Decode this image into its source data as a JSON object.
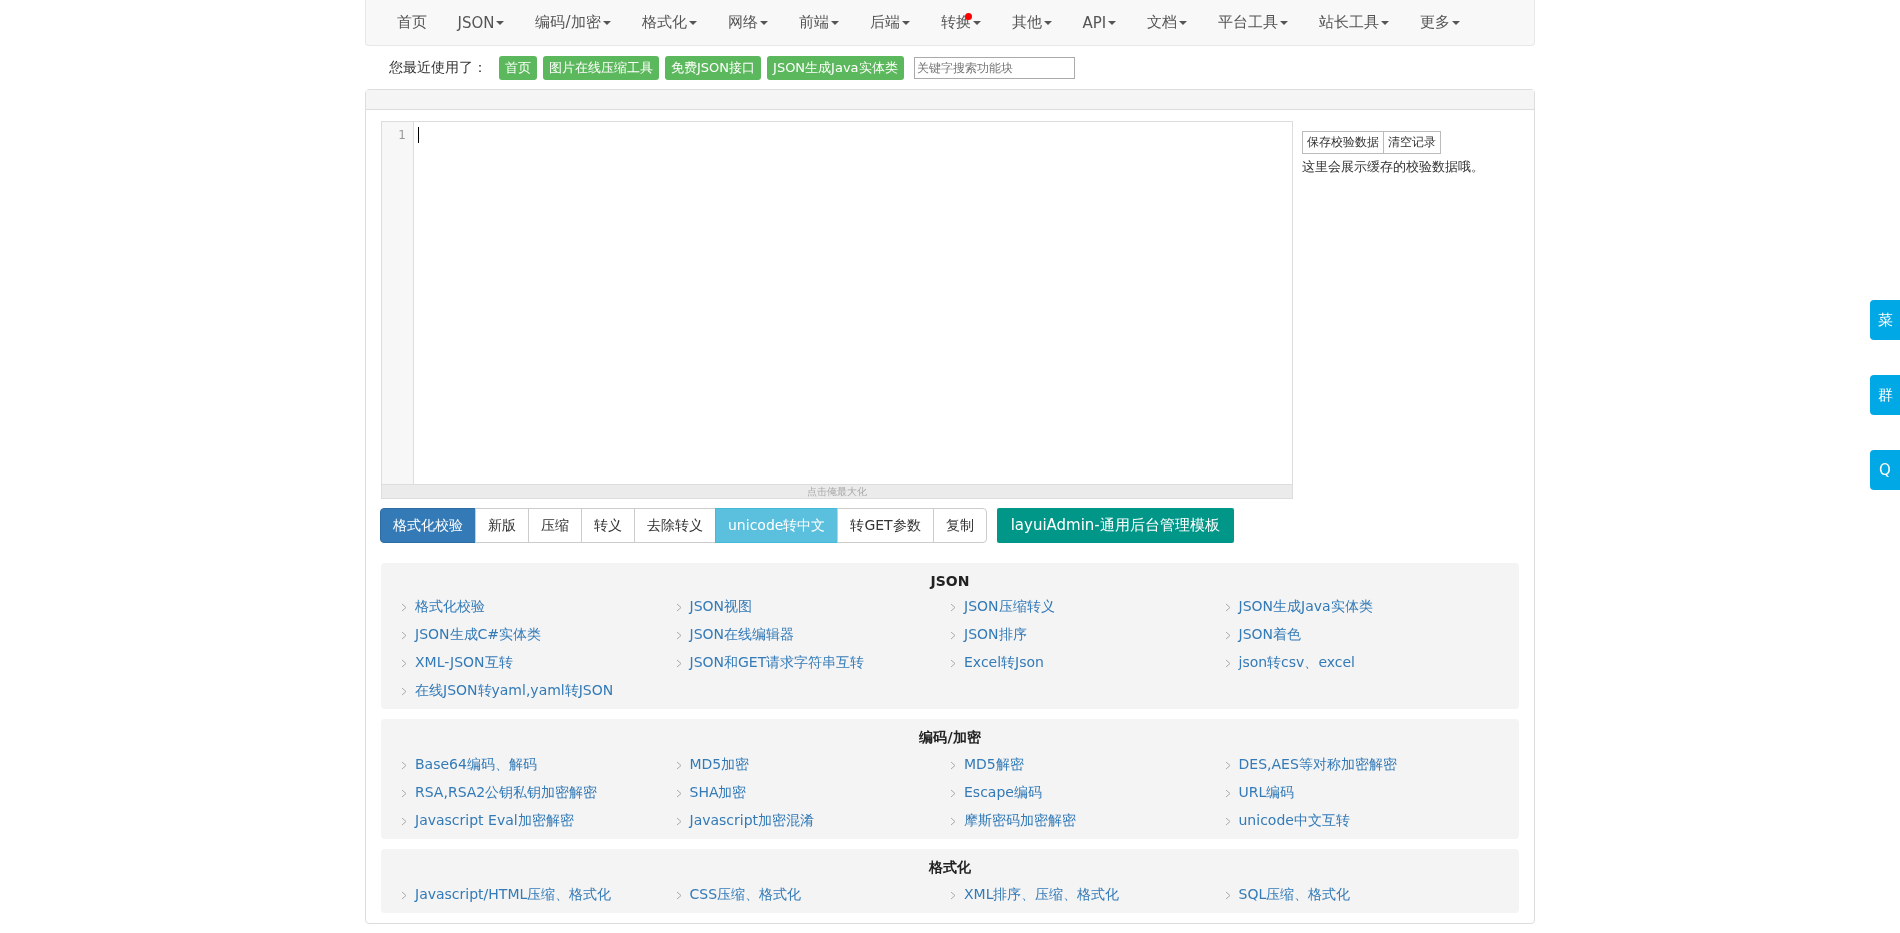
{
  "nav": [
    {
      "label": "首页",
      "dropdown": false,
      "dot": false
    },
    {
      "label": "JSON",
      "dropdown": true,
      "dot": false
    },
    {
      "label": "编码/加密",
      "dropdown": true,
      "dot": false
    },
    {
      "label": "格式化",
      "dropdown": true,
      "dot": false
    },
    {
      "label": "网络",
      "dropdown": true,
      "dot": false
    },
    {
      "label": "前端",
      "dropdown": true,
      "dot": false
    },
    {
      "label": "后端",
      "dropdown": true,
      "dot": false
    },
    {
      "label": "转换",
      "dropdown": true,
      "dot": true
    },
    {
      "label": "其他",
      "dropdown": true,
      "dot": false
    },
    {
      "label": "API",
      "dropdown": true,
      "dot": false
    },
    {
      "label": "文档",
      "dropdown": true,
      "dot": false
    },
    {
      "label": "平台工具",
      "dropdown": true,
      "dot": false
    },
    {
      "label": "站长工具",
      "dropdown": true,
      "dot": false
    },
    {
      "label": "更多",
      "dropdown": true,
      "dot": false
    }
  ],
  "recent": {
    "label": "您最近使用了：",
    "tags": [
      "首页",
      "图片在线压缩工具",
      "免费JSON接口",
      "JSON生成Java实体类"
    ],
    "search": {
      "placeholder": "关键字搜索功能块"
    }
  },
  "editor": {
    "line_numbers": [
      "1"
    ],
    "maximize_hint": "点击俺最大化"
  },
  "cache": {
    "buttons": [
      "保存校验数据",
      "清空记录"
    ],
    "note": "这里会展示缓存的校验数据哦。"
  },
  "actions": [
    {
      "label": "格式化校验",
      "kind": "primary"
    },
    {
      "label": "新版",
      "kind": "default"
    },
    {
      "label": "压缩",
      "kind": "default"
    },
    {
      "label": "转义",
      "kind": "default"
    },
    {
      "label": "去除转义",
      "kind": "default"
    },
    {
      "label": "unicode转中文",
      "kind": "info"
    },
    {
      "label": "转GET参数",
      "kind": "default"
    },
    {
      "label": "复制",
      "kind": "default"
    }
  ],
  "promo_button": "layuiAdmin-通用后台管理模板",
  "sections": [
    {
      "title": "JSON",
      "links": [
        "格式化校验",
        "JSON视图",
        "JSON压缩转义",
        "JSON生成Java实体类",
        "JSON生成C#实体类",
        "JSON在线编辑器",
        "JSON排序",
        "JSON着色",
        "XML-JSON互转",
        "JSON和GET请求字符串互转",
        "Excel转Json",
        "json转csv、excel",
        "在线JSON转yaml,yaml转JSON"
      ]
    },
    {
      "title": "编码/加密",
      "links": [
        "Base64编码、解码",
        "MD5加密",
        "MD5解密",
        "DES,AES等对称加密解密",
        "RSA,RSA2公钥私钥加密解密",
        "SHA加密",
        "Escape编码",
        "URL编码",
        "Javascript Eval加密解密",
        "Javascript加密混淆",
        "摩斯密码加密解密",
        "unicode中文互转"
      ]
    },
    {
      "title": "格式化",
      "links": [
        "Javascript/HTML压缩、格式化",
        "CSS压缩、格式化",
        "XML排序、压缩、格式化",
        "SQL压缩、格式化"
      ]
    }
  ],
  "side_buttons": [
    "菜",
    "群",
    "Q"
  ]
}
